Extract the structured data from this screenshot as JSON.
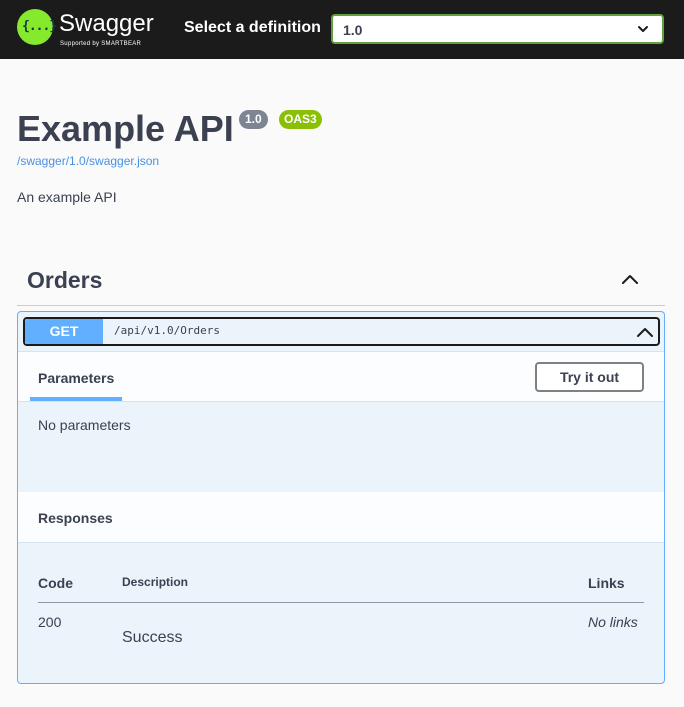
{
  "topbar": {
    "logo_glyph": "{...}",
    "brand": "Swagger",
    "brand_sub": "Supported by SMARTBEAR",
    "definition_label": "Select a definition",
    "definition_value": "1.0",
    "logo_color": "#85ea2d"
  },
  "info": {
    "title": "Example API",
    "version_badge": "1.0",
    "oas_badge": "OAS3",
    "spec_url": "/swagger/1.0/swagger.json",
    "description": "An example API"
  },
  "tag": {
    "name": "Orders",
    "expanded": true
  },
  "operation": {
    "method": "GET",
    "path": "/api/v1.0/Orders",
    "method_color": "#61affe",
    "parameters_tab": "Parameters",
    "try_button": "Try it out",
    "no_params_text": "No parameters",
    "responses_title": "Responses",
    "response_columns": {
      "code": "Code",
      "description": "Description",
      "links": "Links"
    },
    "responses": [
      {
        "code": "200",
        "description": "Success",
        "links": "No links"
      }
    ]
  },
  "icons": {
    "select_chevron": "chevron-down-icon",
    "tag_toggle": "chevron-up-icon",
    "op_toggle": "chevron-up-icon"
  }
}
